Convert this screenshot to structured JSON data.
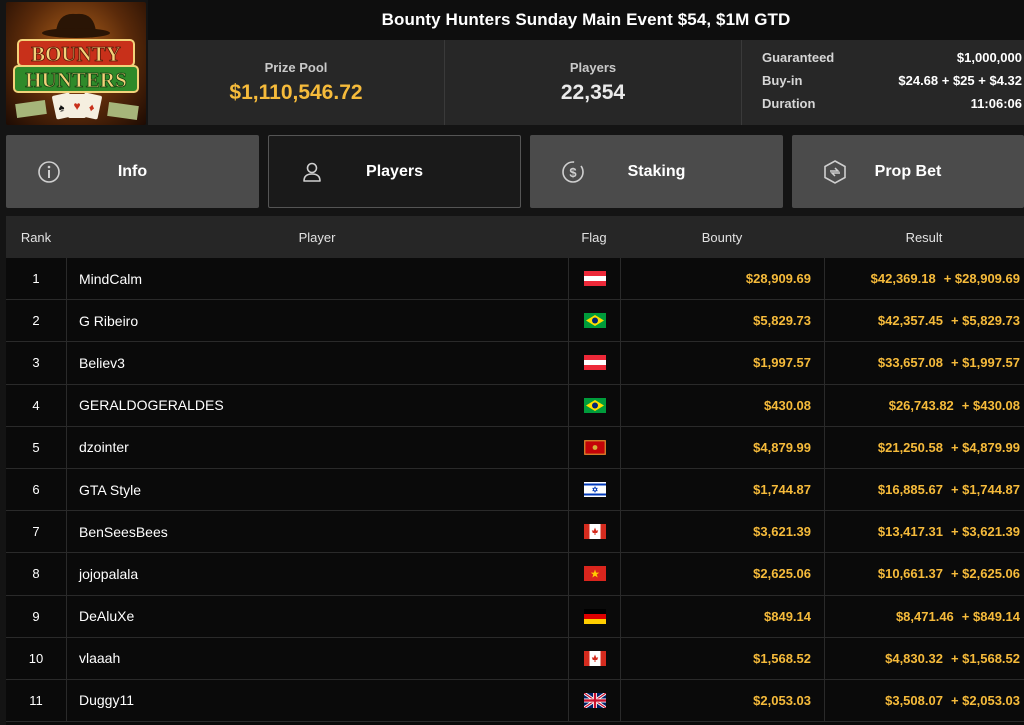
{
  "header": {
    "logo": {
      "line1": "BOUNTY",
      "line2": "HUNTERS"
    },
    "title": "Bounty Hunters Sunday Main Event $54, $1M GTD",
    "prize_pool_label": "Prize Pool",
    "prize_pool_value": "$1,110,546.72",
    "players_label": "Players",
    "players_value": "22,354",
    "details": [
      {
        "label": "Guaranteed",
        "value": "$1,000,000"
      },
      {
        "label": "Buy-in",
        "value": "$24.68 + $25 + $4.32"
      },
      {
        "label": "Duration",
        "value": "11:06:06"
      }
    ]
  },
  "tabs": [
    {
      "label": "Info",
      "icon": "info-icon"
    },
    {
      "label": "Players",
      "icon": "user-icon",
      "active": true
    },
    {
      "label": "Staking",
      "icon": "dollar-coin-icon"
    },
    {
      "label": "Prop Bet",
      "icon": "prop-bet-icon"
    }
  ],
  "table": {
    "headers": {
      "rank": "Rank",
      "player": "Player",
      "flag": "Flag",
      "bounty": "Bounty",
      "result": "Result"
    },
    "rows": [
      {
        "rank": "1",
        "player": "MindCalm",
        "flag": "austria",
        "bounty": "$28,909.69",
        "result": "$42,369.18",
        "bonus": "+ $28,909.69"
      },
      {
        "rank": "2",
        "player": "G Ribeiro",
        "flag": "brazil",
        "bounty": "$5,829.73",
        "result": "$42,357.45",
        "bonus": "+ $5,829.73"
      },
      {
        "rank": "3",
        "player": "Believ3",
        "flag": "austria",
        "bounty": "$1,997.57",
        "result": "$33,657.08",
        "bonus": "+ $1,997.57"
      },
      {
        "rank": "4",
        "player": "GERALDOGERALDES",
        "flag": "brazil",
        "bounty": "$430.08",
        "result": "$26,743.82",
        "bonus": "+ $430.08"
      },
      {
        "rank": "5",
        "player": "dzointer",
        "flag": "montenegro",
        "bounty": "$4,879.99",
        "result": "$21,250.58",
        "bonus": "+ $4,879.99"
      },
      {
        "rank": "6",
        "player": "GTA Style",
        "flag": "israel",
        "bounty": "$1,744.87",
        "result": "$16,885.67",
        "bonus": "+ $1,744.87"
      },
      {
        "rank": "7",
        "player": "BenSeesBees",
        "flag": "canada",
        "bounty": "$3,621.39",
        "result": "$13,417.31",
        "bonus": "+ $3,621.39"
      },
      {
        "rank": "8",
        "player": "jojopalala",
        "flag": "vietnam",
        "bounty": "$2,625.06",
        "result": "$10,661.37",
        "bonus": "+ $2,625.06"
      },
      {
        "rank": "9",
        "player": "DeAluXe",
        "flag": "germany",
        "bounty": "$849.14",
        "result": "$8,471.46",
        "bonus": "+ $849.14"
      },
      {
        "rank": "10",
        "player": "vlaaah",
        "flag": "canada",
        "bounty": "$1,568.52",
        "result": "$4,830.32",
        "bonus": "+ $1,568.52"
      },
      {
        "rank": "11",
        "player": "Duggy11",
        "flag": "uk",
        "bounty": "$2,053.03",
        "result": "$3,508.07",
        "bonus": "+ $2,053.03"
      }
    ]
  },
  "colors": {
    "gold": "#f6bb3b",
    "background": "#0a0a0a",
    "tab": "#4b4b4b"
  }
}
